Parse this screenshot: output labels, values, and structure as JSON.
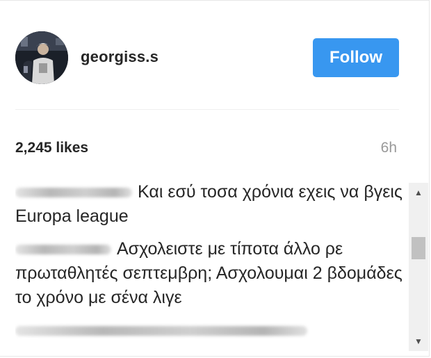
{
  "post_header": {
    "username": "georgiss.s",
    "follow_label": "Follow",
    "avatar_icon": "user-avatar-photo"
  },
  "stats": {
    "likes": "2,245 likes",
    "time_ago": "6h"
  },
  "comments": [
    {
      "author": "",
      "text": "Και εσύ τοσα χρόνια εχεις να βγεις Europa league"
    },
    {
      "author": "",
      "text": "Ασχολειστε με τίποτα άλλο ρε πρωταθλητές σεπτεμβρη; Ασχολουμαι 2 βδομάδες το χρόνο με σένα λιγε"
    }
  ],
  "colors": {
    "follow_button": "#3897f0",
    "username": "#262626",
    "time": "#999999"
  }
}
